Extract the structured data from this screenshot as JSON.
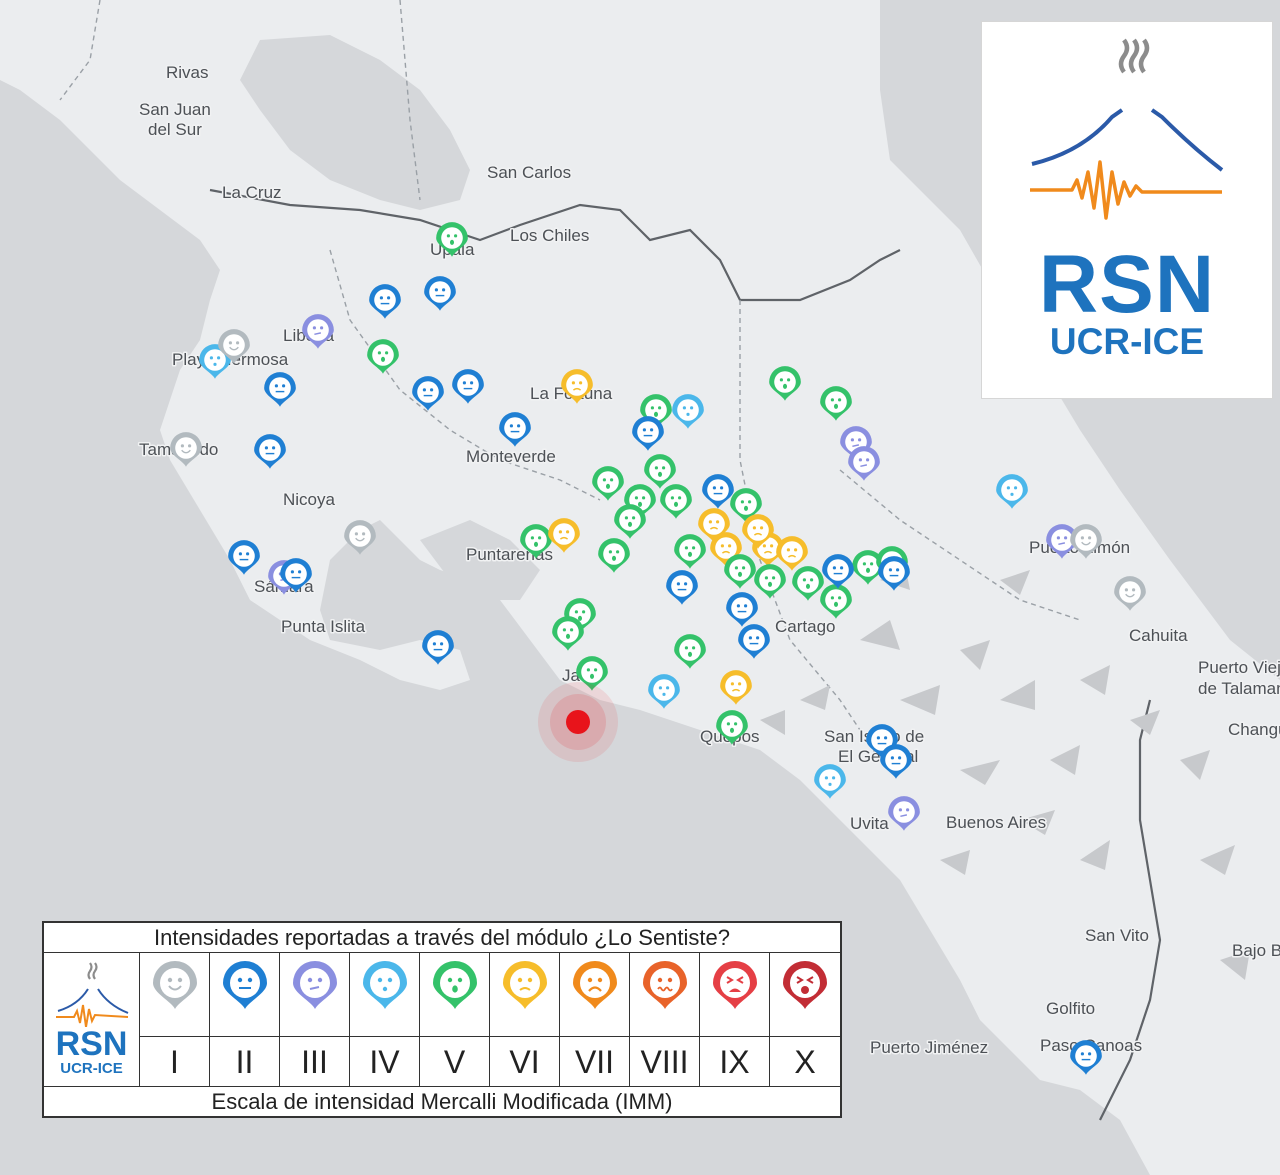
{
  "places": [
    {
      "name": "Rivas"
    },
    {
      "name": "San Juan"
    },
    {
      "name": "del Sur"
    },
    {
      "name": "La Cruz"
    },
    {
      "name": "San Carlos"
    },
    {
      "name": "Los Chiles"
    },
    {
      "name": "Upala"
    },
    {
      "name": "Liberia"
    },
    {
      "name": "Playa Hermosa"
    },
    {
      "name": "La Fortuna"
    },
    {
      "name": "Tamarindo"
    },
    {
      "name": "Monteverde"
    },
    {
      "name": "Nicoya"
    },
    {
      "name": "Puntarenas"
    },
    {
      "name": "Sámara"
    },
    {
      "name": "Punta Islita"
    },
    {
      "name": "Cartago"
    },
    {
      "name": "Jacó"
    },
    {
      "name": "Quepos"
    },
    {
      "name": "San Isidro de"
    },
    {
      "name": "El General"
    },
    {
      "name": "Uvita"
    },
    {
      "name": "Buenos Aires"
    },
    {
      "name": "Puerto Limón"
    },
    {
      "name": "Cahuita"
    },
    {
      "name": "Puerto Viejo"
    },
    {
      "name": "de Talamanca"
    },
    {
      "name": "Changuinola"
    },
    {
      "name": "San Vito"
    },
    {
      "name": "Bajo Boquete"
    },
    {
      "name": "Golfito"
    },
    {
      "name": "Puerto Jiménez"
    },
    {
      "name": "Paso Canoas"
    }
  ],
  "logo": {
    "name": "RSN",
    "subtitle": "UCR-ICE"
  },
  "legend": {
    "title": "Intensidades reportadas a través del módulo ¿Lo Sentiste?",
    "footer": "Escala de intensidad Mercalli Modificada (IMM)",
    "logo_name": "RSN",
    "logo_subtitle": "UCR-ICE",
    "levels": [
      {
        "numeral": "I",
        "color": "#b2babf",
        "face": "smile"
      },
      {
        "numeral": "II",
        "color": "#1f7fd3",
        "face": "neutral"
      },
      {
        "numeral": "III",
        "color": "#8a8fe0",
        "face": "meh"
      },
      {
        "numeral": "IV",
        "color": "#4bb7ea",
        "face": "surprised"
      },
      {
        "numeral": "V",
        "color": "#34c26a",
        "face": "shock"
      },
      {
        "numeral": "VI",
        "color": "#f6bd2b",
        "face": "frown"
      },
      {
        "numeral": "VII",
        "color": "#f08a1c",
        "face": "sad"
      },
      {
        "numeral": "VIII",
        "color": "#e8632a",
        "face": "wavy"
      },
      {
        "numeral": "IX",
        "color": "#e53f45",
        "face": "distress"
      },
      {
        "numeral": "X",
        "color": "#c22d35",
        "face": "scream"
      }
    ]
  },
  "epicenter_color": "#e8141b",
  "report_markers": [
    {
      "level": "V",
      "n": 4
    },
    {
      "level": "II",
      "n": 16
    },
    {
      "level": "III",
      "n": 4
    },
    {
      "level": "IV",
      "n": 10
    },
    {
      "level": "VI",
      "n": 8
    },
    {
      "level": "I",
      "n": 5
    }
  ]
}
